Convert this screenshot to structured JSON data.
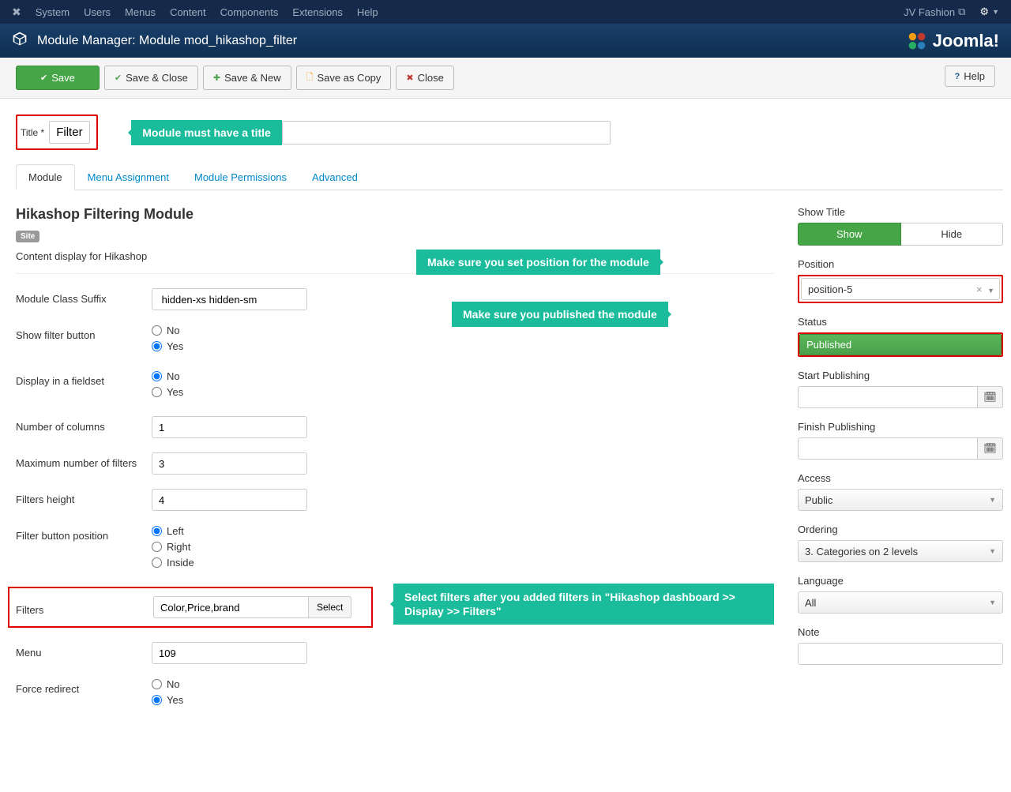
{
  "topnav": {
    "items": [
      "System",
      "Users",
      "Menus",
      "Content",
      "Components",
      "Extensions",
      "Help"
    ],
    "site_name": "JV Fashion"
  },
  "header": {
    "title": "Module Manager: Module mod_hikashop_filter"
  },
  "toolbar": {
    "save": "Save",
    "save_close": "Save & Close",
    "save_new": "Save & New",
    "save_copy": "Save as Copy",
    "close": "Close",
    "help": "Help"
  },
  "title_field": {
    "label": "Title *",
    "value": "Filter",
    "callout": "Module must have a title"
  },
  "tabs": [
    "Module",
    "Menu Assignment",
    "Module Permissions",
    "Advanced"
  ],
  "module": {
    "heading": "Hikashop Filtering Module",
    "badge": "Site",
    "description": "Content display for Hikashop",
    "fields": {
      "suffix": {
        "label": "Module Class Suffix",
        "value": " hidden-xs hidden-sm"
      },
      "show_filter_btn": {
        "label": "Show filter button",
        "options": [
          "No",
          "Yes"
        ],
        "value": "Yes"
      },
      "display_fieldset": {
        "label": "Display in a fieldset",
        "options": [
          "No",
          "Yes"
        ],
        "value": "No"
      },
      "num_columns": {
        "label": "Number of columns",
        "value": "1"
      },
      "max_filters": {
        "label": "Maximum number of filters",
        "value": "3"
      },
      "filters_height": {
        "label": "Filters height",
        "value": "4"
      },
      "filter_btn_pos": {
        "label": "Filter button position",
        "options": [
          "Left",
          "Right",
          "Inside"
        ],
        "value": "Left"
      },
      "filters": {
        "label": "Filters",
        "value": "Color,Price,brand",
        "button": "Select",
        "callout": "Select filters after you added filters in \"Hikashop dashboard >> Display >> Filters\""
      },
      "menu": {
        "label": "Menu",
        "value": "109"
      },
      "force_redirect": {
        "label": "Force redirect",
        "options": [
          "No",
          "Yes"
        ],
        "value": "Yes"
      }
    }
  },
  "sidebar": {
    "show_title": {
      "label": "Show Title",
      "show": "Show",
      "hide": "Hide"
    },
    "position": {
      "label": "Position",
      "value": "position-5",
      "callout": "Make sure you set position for the module"
    },
    "status": {
      "label": "Status",
      "value": "Published",
      "callout": "Make sure you published the module"
    },
    "start_pub": {
      "label": "Start Publishing"
    },
    "finish_pub": {
      "label": "Finish Publishing"
    },
    "access": {
      "label": "Access",
      "value": "Public"
    },
    "ordering": {
      "label": "Ordering",
      "value": "3. Categories on 2 levels"
    },
    "language": {
      "label": "Language",
      "value": "All"
    },
    "note": {
      "label": "Note"
    }
  }
}
